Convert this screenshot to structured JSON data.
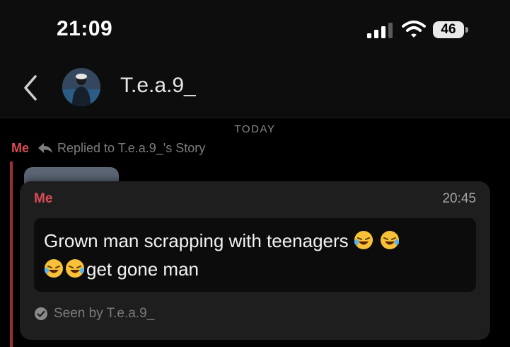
{
  "status_bar": {
    "time": "21:09",
    "battery": "46",
    "icons": [
      "signal-icon",
      "wifi-icon",
      "battery-icon"
    ]
  },
  "header": {
    "back_icon": "chevron-left-icon",
    "contact_name": "T.e.a.9_"
  },
  "chat": {
    "day_separator": "TODAY",
    "reply_sender": "Me",
    "reply_icon": "reply-arrow-icon",
    "reply_text": "Replied to T.e.a.9_'s Story"
  },
  "message_card": {
    "sender": "Me",
    "time": "20:45",
    "text_line1": "Grown man scrapping with teenagers",
    "text_line2": "get gone man",
    "emoji": "rolling-on-floor-laughing-emoji",
    "seen_text": "Seen by T.e.a.9_"
  },
  "colors": {
    "accent_red": "#d94b55",
    "background": "#000000",
    "card_background": "#1e1e1f"
  }
}
